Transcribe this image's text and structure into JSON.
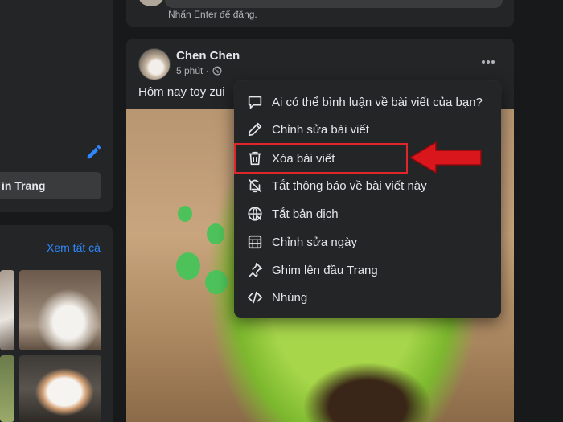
{
  "left_sidebar": {
    "page_button_label": "in Trang",
    "see_all_link": "Xem tất cả"
  },
  "composer": {
    "hint": "Nhấn Enter để đăng."
  },
  "post": {
    "author": "Chen Chen",
    "time": "5 phút ·",
    "text": "Hôm nay toy zui"
  },
  "menu": {
    "items": [
      {
        "label": "Ai có thể bình luận về bài viết của bạn?",
        "icon": "comment-icon"
      },
      {
        "label": "Chỉnh sửa bài viết",
        "icon": "pencil-icon"
      },
      {
        "label": "Xóa bài viết",
        "icon": "trash-icon"
      },
      {
        "label": "Tắt thông báo về bài viết này",
        "icon": "bell-off-icon"
      },
      {
        "label": "Tắt bản dịch",
        "icon": "globe-translate-icon"
      },
      {
        "label": "Chỉnh sửa ngày",
        "icon": "calendar-icon"
      },
      {
        "label": "Ghim lên đầu Trang",
        "icon": "pin-icon"
      },
      {
        "label": "Nhúng",
        "icon": "code-icon"
      }
    ],
    "highlighted_index": 2
  },
  "colors": {
    "background": "#18191a",
    "card": "#242526",
    "accent": "#2d88ff",
    "highlight": "#e0262a"
  }
}
